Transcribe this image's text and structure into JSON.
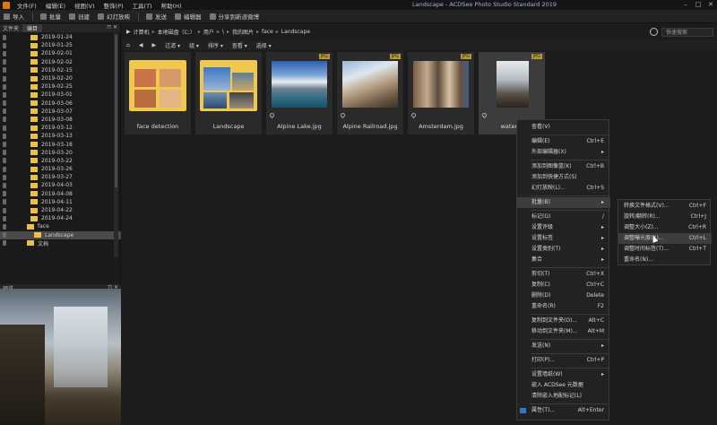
{
  "menubar": {
    "items": [
      "文件(F)",
      "编辑(E)",
      "视图(V)",
      "整饰(P)",
      "工具(T)",
      "帮助(H)"
    ],
    "window_title": "Landscape - ACDSee Photo Studio Standard 2019"
  },
  "toolbar": {
    "buttons": [
      "导入",
      "批量",
      "创建",
      "幻灯放映",
      "发送",
      "编辑器",
      "分享到新浪微博"
    ]
  },
  "left_panel": {
    "title": "文件夹",
    "tab": "编目",
    "folders": [
      "2019-01-24",
      "2019-01-25",
      "2019-02-01",
      "2019-02-02",
      "2019-02-15",
      "2019-02-20",
      "2019-02-25",
      "2019-03-01",
      "2019-03-06",
      "2019-03-07",
      "2019-03-08",
      "2019-03-12",
      "2019-03-13",
      "2019-03-18",
      "2019-03-20",
      "2019-03-22",
      "2019-03-26",
      "2019-03-27",
      "2019-04-03",
      "2019-04-08",
      "2019-04-11",
      "2019-04-22",
      "2019-04-24",
      "face",
      "Landscape",
      "文档"
    ],
    "selected_folder": "Landscape",
    "preview_title": "预览"
  },
  "pathbar": {
    "crumbs": [
      "计算机",
      "本地磁盘（C:）",
      "用户",
      "\\",
      "我的图片",
      "face",
      "Landscape"
    ],
    "search_placeholder": "快速搜索"
  },
  "filterbar": {
    "items": [
      "过滤 ▾",
      "组 ▾",
      "排序 ▾",
      "查看 ▾",
      "选择 ▾"
    ]
  },
  "tiles": [
    {
      "name": "face detection",
      "kind": "folder"
    },
    {
      "name": "Landscape",
      "kind": "folder"
    },
    {
      "name": "Alpine Lake.jpg",
      "kind": "image",
      "badge": "JPG"
    },
    {
      "name": "Alpine Railroad.jpg",
      "kind": "image",
      "badge": "JPG"
    },
    {
      "name": "Amsterdam.jpg",
      "kind": "image",
      "badge": "JPG"
    },
    {
      "name": "waterfa",
      "kind": "image",
      "badge": "JPG"
    }
  ],
  "context_menu": {
    "items": [
      {
        "label": "查看(V)",
        "shortcut": ""
      },
      {
        "label": "编辑(E)",
        "shortcut": "Ctrl+E"
      },
      {
        "label": "外部编辑器(X)",
        "shortcut": "▸"
      },
      {
        "label": "添加到图像篮(K)",
        "shortcut": "Ctrl+B"
      },
      {
        "label": "添加到快捷方式(S)",
        "shortcut": ""
      },
      {
        "label": "幻灯放映(L)...",
        "shortcut": "Ctrl+S"
      },
      {
        "label": "批量(B)",
        "shortcut": "▸"
      },
      {
        "label": "标记(G)",
        "shortcut": "/"
      },
      {
        "label": "设置评级",
        "shortcut": "▸"
      },
      {
        "label": "设置标签",
        "shortcut": "▸"
      },
      {
        "label": "设置类别(T)",
        "shortcut": "▸"
      },
      {
        "label": "集合",
        "shortcut": "▸"
      },
      {
        "label": "剪切(T)",
        "shortcut": "Ctrl+X"
      },
      {
        "label": "复制(C)",
        "shortcut": "Ctrl+C"
      },
      {
        "label": "删除(D)",
        "shortcut": "Delete"
      },
      {
        "label": "重命名(R)",
        "shortcut": "F2"
      },
      {
        "label": "复制到文件夹(O)...",
        "shortcut": "Alt+C"
      },
      {
        "label": "移动到文件夹(M)...",
        "shortcut": "Alt+M"
      },
      {
        "label": "发送(N)",
        "shortcut": "▸"
      },
      {
        "label": "打印(P)...",
        "shortcut": "Ctrl+P"
      },
      {
        "label": "设置墙纸(W)",
        "shortcut": "▸"
      },
      {
        "label": "嵌入 ACDSee 元数据",
        "shortcut": ""
      },
      {
        "label": "清除嵌入地配标记(L)",
        "shortcut": ""
      },
      {
        "label": "属性(T)...",
        "shortcut": "Alt+Enter"
      }
    ]
  },
  "submenu": {
    "items": [
      {
        "label": "转换文件格式(V)...",
        "shortcut": "Ctrl+F"
      },
      {
        "label": "旋转/翻转(R)...",
        "shortcut": "Ctrl+J"
      },
      {
        "label": "调整大小(Z)...",
        "shortcut": "Ctrl+R"
      },
      {
        "label": "调整曝光度(X)...",
        "shortcut": "Ctrl+L"
      },
      {
        "label": "调整时间标签(T)...",
        "shortcut": "Ctrl+T"
      },
      {
        "label": "重命名(N)...",
        "shortcut": ""
      }
    ]
  }
}
